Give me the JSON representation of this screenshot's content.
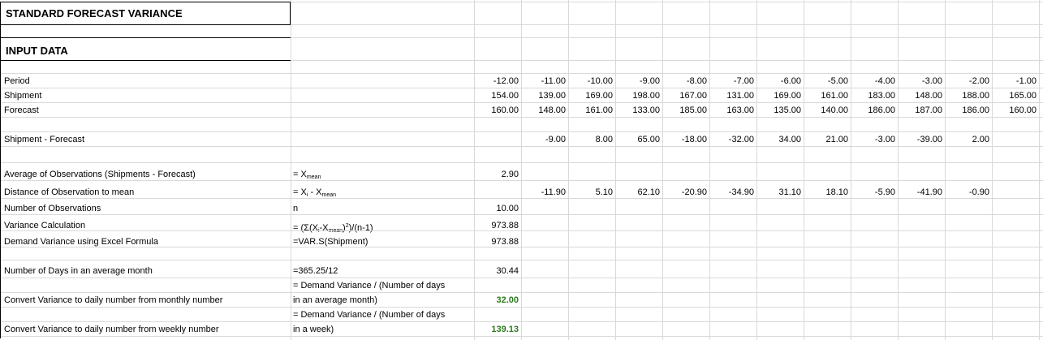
{
  "sheet": {
    "title": "STANDARD FORECAST VARIANCE",
    "section_label": "INPUT DATA",
    "rows": {
      "period": {
        "label": "Period",
        "values": [
          "-12.00",
          "-11.00",
          "-10.00",
          "-9.00",
          "-8.00",
          "-7.00",
          "-6.00",
          "-5.00",
          "-4.00",
          "-3.00",
          "-2.00",
          "-1.00"
        ]
      },
      "shipment": {
        "label": "Shipment",
        "values": [
          "154.00",
          "139.00",
          "169.00",
          "198.00",
          "167.00",
          "131.00",
          "169.00",
          "161.00",
          "183.00",
          "148.00",
          "188.00",
          "165.00"
        ]
      },
      "forecast": {
        "label": "Forecast",
        "values": [
          "160.00",
          "148.00",
          "161.00",
          "133.00",
          "185.00",
          "163.00",
          "135.00",
          "140.00",
          "186.00",
          "187.00",
          "186.00",
          "160.00"
        ]
      },
      "diff": {
        "label": "Shipment - Forecast",
        "values": [
          "-9.00",
          "8.00",
          "65.00",
          "-18.00",
          "-32.00",
          "34.00",
          "21.00",
          "-3.00",
          "-39.00",
          "2.00"
        ]
      },
      "avg": {
        "label": "Average of Observations (Shipments - Forecast)",
        "formula_prefix": "= X",
        "formula_sub": "mean",
        "value": "2.90"
      },
      "dist": {
        "label": "Distance of Observation to mean",
        "f1": "= X",
        "f1sub": "i",
        "f2": " - X",
        "f2sub": "mean",
        "values": [
          "-11.90",
          "5.10",
          "62.10",
          "-20.90",
          "-34.90",
          "31.10",
          "18.10",
          "-5.90",
          "-41.90",
          "-0.90"
        ]
      },
      "nobs": {
        "label": "Number of Observations",
        "formula": "n",
        "value": "10.00"
      },
      "var": {
        "label": "Variance Calculation",
        "f_a": "= (Σ(X",
        "f_a_sub": "i",
        "f_b": "-X",
        "f_b_sub": "mean",
        "f_c": ")",
        "f_c_sup": "2",
        "f_d": ")/(n-1)",
        "value": "973.88"
      },
      "excel": {
        "label": "Demand Variance using Excel Formula",
        "formula": "=VAR.S(Shipment)",
        "value": "973.88"
      },
      "days": {
        "label": "Number of Days in an average month",
        "formula": "=365.25/12",
        "value": "30.44"
      },
      "daily_m": {
        "label": "Convert Variance to daily number from monthly number",
        "formula_line1": "= Demand Variance / (Number of days",
        "formula_line2": "in an average month)",
        "value": "32.00"
      },
      "daily_w": {
        "label": "Convert Variance to daily number from weekly number",
        "formula_line1": "= Demand Variance / (Number of days",
        "formula_line2": "in a week)",
        "value": "139.13"
      }
    }
  }
}
